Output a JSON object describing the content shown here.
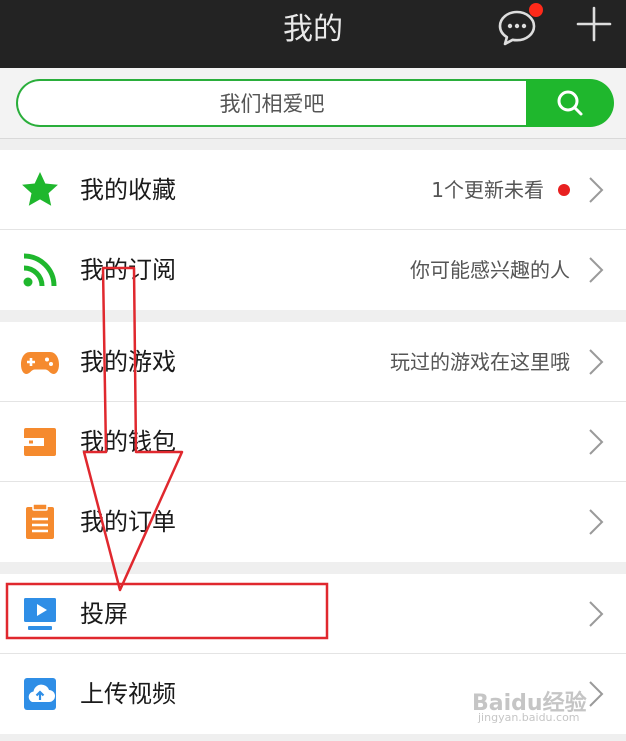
{
  "header": {
    "title": "我的"
  },
  "search": {
    "text": "我们相爱吧"
  },
  "menu": {
    "favorites": {
      "label": "我的收藏",
      "note": "1个更新未看"
    },
    "subscriptions": {
      "label": "我的订阅",
      "note": "你可能感兴趣的人"
    },
    "games": {
      "label": "我的游戏",
      "note": "玩过的游戏在这里哦"
    },
    "wallet": {
      "label": "我的钱包"
    },
    "orders": {
      "label": "我的订单"
    },
    "cast": {
      "label": "投屏"
    },
    "upload": {
      "label": "上传视频"
    }
  },
  "watermark": {
    "brand": "Baidu经验",
    "url": "jingyan.baidu.com"
  },
  "colors": {
    "topbar": "#232323",
    "accent_green": "#1fb72d",
    "game_orange": "#f58a2e",
    "cast_blue": "#2f8ee6",
    "annotation_red": "#e0282e"
  }
}
